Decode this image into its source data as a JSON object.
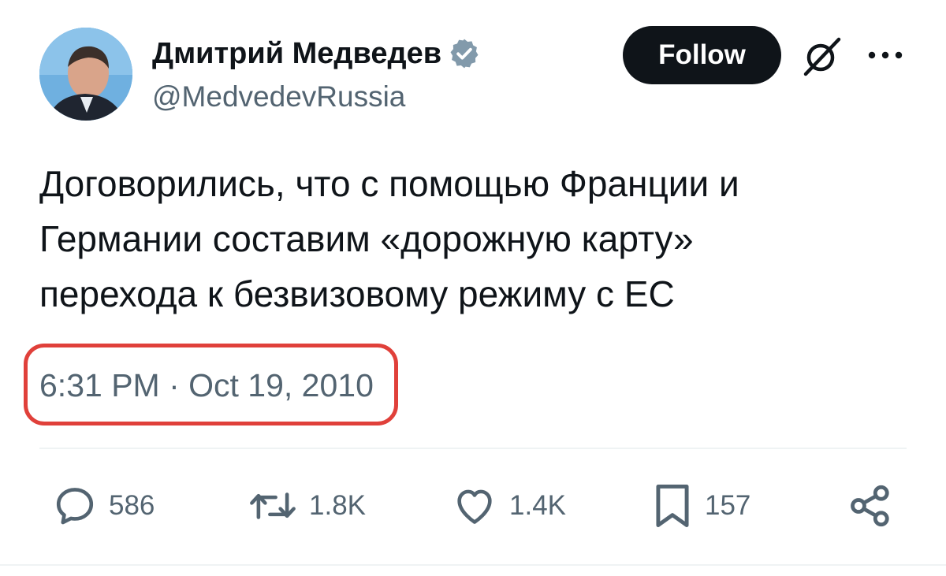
{
  "tweet": {
    "author": {
      "display_name": "Дмитрий Медведев",
      "handle": "@MedvedevRussia",
      "verified_color": "#829aab"
    },
    "follow_label": "Follow",
    "text_lines": [
      "Договорились, что с помощью Франции и",
      "Германии составим «дорожную карту»",
      "перехода к безвизовому режиму с ЕС"
    ],
    "timestamp": "6:31 PM · Oct 19, 2010",
    "highlight_color": "#e0403a",
    "actions": {
      "replies": "586",
      "reposts": "1.8K",
      "likes": "1.4K",
      "bookmarks": "157"
    },
    "icons": {
      "verified": "verified-badge-icon",
      "grok": "grok-icon",
      "more": "more-dots-icon",
      "reply": "reply-icon",
      "repost": "repost-icon",
      "like": "heart-icon",
      "bookmark": "bookmark-icon",
      "share": "share-icon"
    }
  }
}
